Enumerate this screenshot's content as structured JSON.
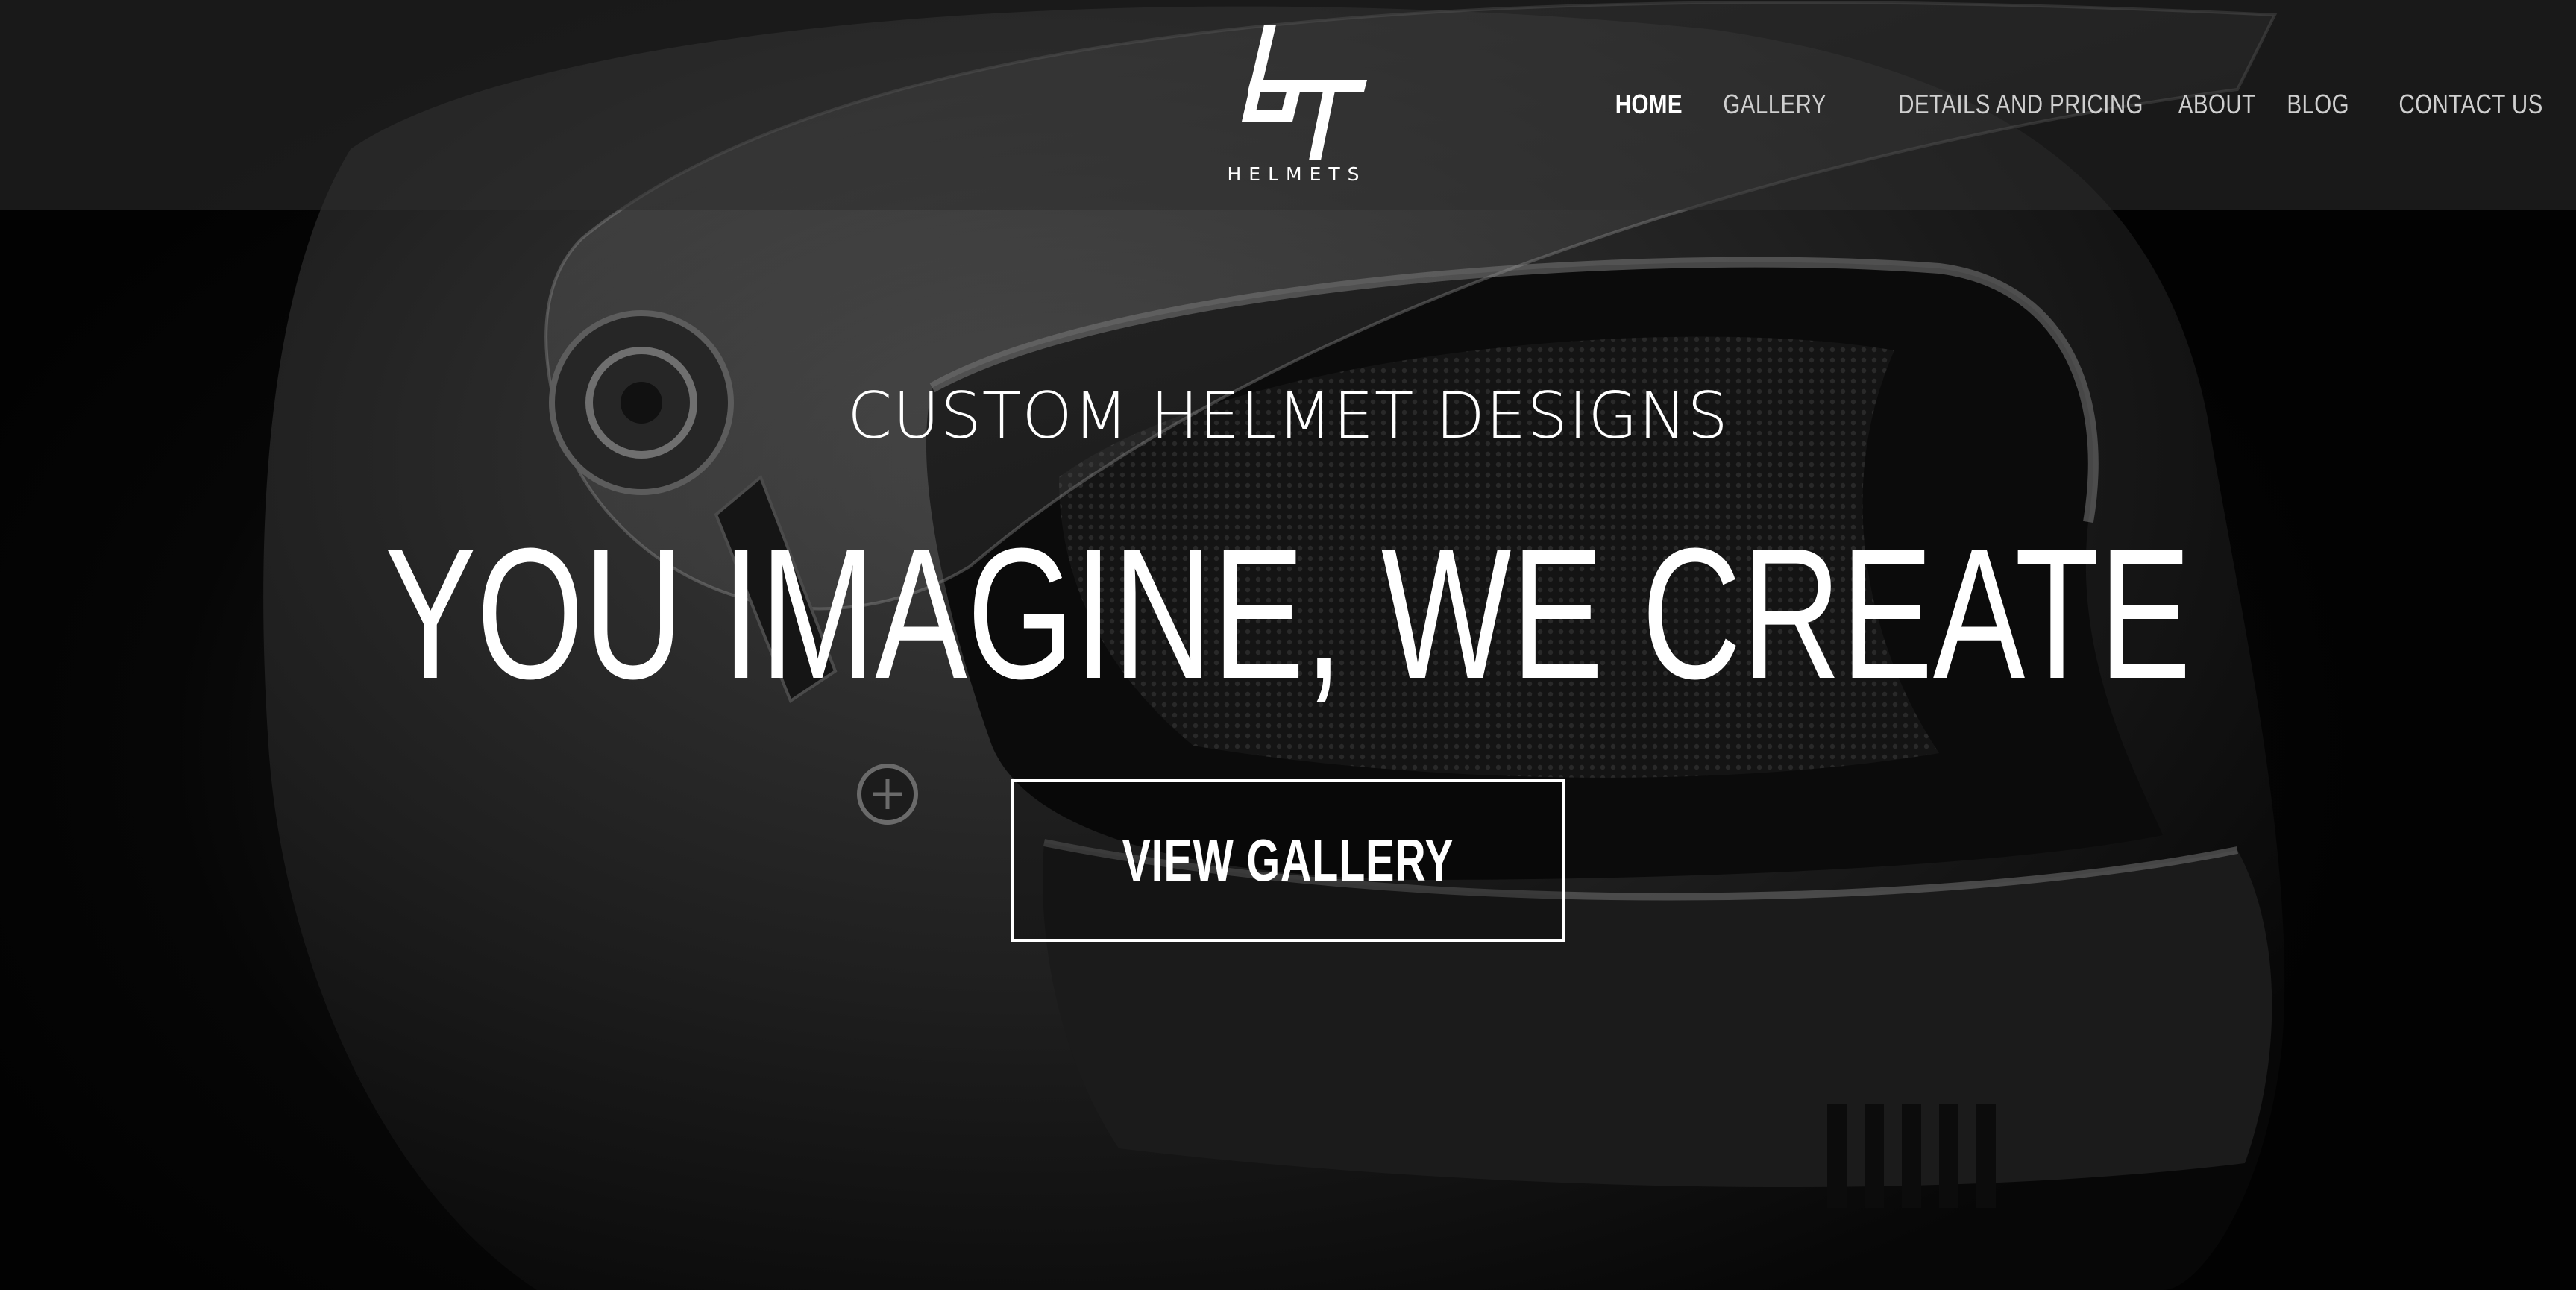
{
  "brand": {
    "logo_word": "HELMETS",
    "logo_mark": "bT"
  },
  "nav": {
    "items": [
      {
        "label": "HOME",
        "active": true
      },
      {
        "label": "GALLERY",
        "active": false
      },
      {
        "label": "DETAILS AND PRICING",
        "active": false
      },
      {
        "label": "ABOUT",
        "active": false
      },
      {
        "label": "BLOG",
        "active": false
      },
      {
        "label": "CONTACT US",
        "active": false
      }
    ]
  },
  "hero": {
    "subtitle": "CUSTOM HELMET DESIGNS",
    "title": "YOU IMAGINE, WE CREATE",
    "cta_label": "VIEW GALLERY"
  },
  "colors": {
    "text": "#ffffff",
    "nav_inactive": "#cfcfcf",
    "background": "#050505"
  }
}
